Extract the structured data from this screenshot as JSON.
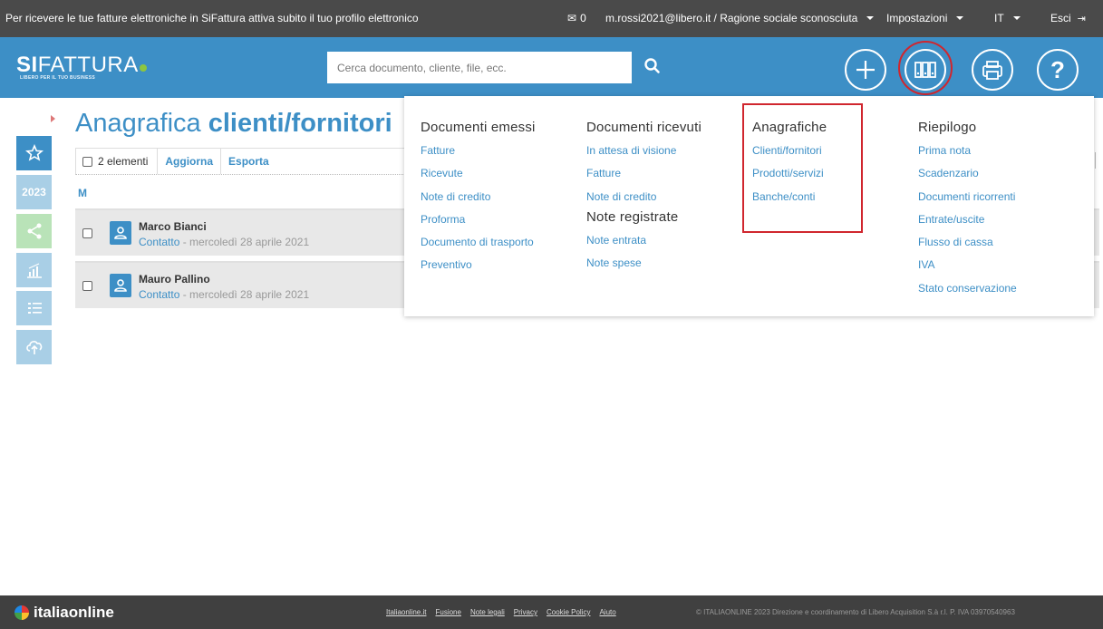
{
  "topbar": {
    "promo": "Per ricevere le tue fatture elettroniche in SiFattura attiva subito il tuo profilo elettronico",
    "mail_count": "0",
    "account": "m.rossi2021@libero.it / Ragione sociale sconosciuta",
    "settings": "Impostazioni",
    "language": "IT",
    "logout": "Esci"
  },
  "header": {
    "logo_bold": "SI",
    "logo_rest": "FATTURA",
    "logo_tagline": "LIBERO PER IL TUO BUSINESS",
    "search_placeholder": "Cerca documento, cliente, file, ecc."
  },
  "sidebar": {
    "year": "2023"
  },
  "page": {
    "title_light": "Anagrafica ",
    "title_bold": "clienti/fornitori",
    "select_count": "2 elementi",
    "refresh": "Aggiorna",
    "export": "Esporta",
    "group_letter": "M"
  },
  "rows": [
    {
      "name": "Marco Bianci",
      "type": "Contatto",
      "date": " - mercoledì 28 aprile 2021"
    },
    {
      "name": "Mauro Pallino",
      "type": "Contatto",
      "date": " - mercoledì 28 aprile 2021"
    }
  ],
  "menu": {
    "issued": {
      "title": "Documenti emessi",
      "items": [
        "Fatture",
        "Ricevute",
        "Note di credito",
        "Proforma",
        "Documento di trasporto",
        "Preventivo"
      ]
    },
    "received": {
      "title": "Documenti ricevuti",
      "items": [
        "In attesa di visione",
        "Fatture",
        "Note di credito"
      ]
    },
    "notes": {
      "title": "Note registrate",
      "items": [
        "Note entrata",
        "Note spese"
      ]
    },
    "registry": {
      "title": "Anagrafiche",
      "items": [
        "Clienti/fornitori",
        "Prodotti/servizi",
        "Banche/conti"
      ]
    },
    "summary": {
      "title": "Riepilogo",
      "items": [
        "Prima nota",
        "Scadenzario",
        "Documenti ricorrenti",
        "Entrate/uscite",
        "Flusso di cassa",
        "IVA",
        "Stato conservazione"
      ]
    }
  },
  "footer": {
    "brand": "italiaonline",
    "links": [
      "Italiaonline.it",
      "Fusione",
      "Note legali",
      "Privacy",
      "Cookie Policy",
      "Aiuto"
    ],
    "copyright": "© ITALIAONLINE 2023   Direzione e coordinamento di Libero Acquisition S.à r.l.   P. IVA 03970540963"
  },
  "colors": {
    "brand_blue": "#3d8fc6",
    "highlight_red": "#d0262e",
    "topbar": "#4a4a4a",
    "footer": "#404040"
  }
}
